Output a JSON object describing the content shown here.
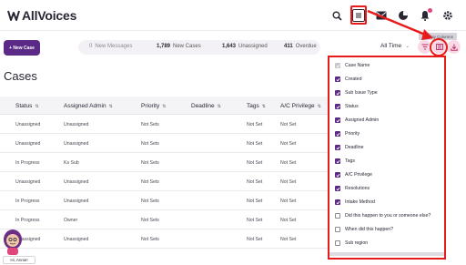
{
  "header": {
    "logo_text": "AllVoices"
  },
  "actions": {
    "new_case_label": "+ New Case",
    "stats": [
      {
        "num": "0",
        "label": "New Messages",
        "muted": true
      },
      {
        "num": "1,789",
        "label": "New Cases",
        "muted": false
      },
      {
        "num": "1,643",
        "label": "Unassigned",
        "muted": false
      },
      {
        "num": "411",
        "label": "Overdue",
        "muted": false
      }
    ],
    "time_filter": "All Time",
    "tooltip": "Display Columns"
  },
  "page": {
    "title": "Cases"
  },
  "table": {
    "headers": [
      "Status",
      "Assigned Admin",
      "Priority",
      "Deadline",
      "Tags",
      "A/C Privilege"
    ],
    "rows": [
      [
        "Unassigned",
        "Unassigned",
        "Not Sets",
        "",
        "Not Set",
        "Not Set"
      ],
      [
        "Unassigned",
        "Unassigned",
        "Not Sets",
        "",
        "Not Set",
        "Not Set"
      ],
      [
        "In Progress",
        "Ks Sub",
        "Not Sets",
        "",
        "Not Set",
        "Not Set"
      ],
      [
        "Unassigned",
        "Unassigned",
        "Not Sets",
        "",
        "Not Set",
        "Not Set"
      ],
      [
        "In Progress",
        "Unassigned",
        "Not Sets",
        "",
        "Not Set",
        "Not Set"
      ],
      [
        "In Progress",
        "Owner",
        "Not Sets",
        "",
        "Not Set",
        "Not Set"
      ],
      [
        "Unassigned",
        "Unassigned",
        "Not Sets",
        "",
        "Not Set",
        "Not Set"
      ]
    ]
  },
  "widget": {
    "greeting": "Hi, Annie!"
  },
  "columns_panel": {
    "items": [
      {
        "label": "Case Name",
        "state": "disabled"
      },
      {
        "label": "Created",
        "state": "checked"
      },
      {
        "label": "Sub Issue Type",
        "state": "checked"
      },
      {
        "label": "Status",
        "state": "checked"
      },
      {
        "label": "Assigned Admin",
        "state": "checked"
      },
      {
        "label": "Priority",
        "state": "checked"
      },
      {
        "label": "Deadline",
        "state": "checked"
      },
      {
        "label": "Tags",
        "state": "checked"
      },
      {
        "label": "A/C Privilege",
        "state": "checked"
      },
      {
        "label": "Resolutions",
        "state": "checked"
      },
      {
        "label": "Intake Method",
        "state": "checked"
      },
      {
        "label": "Did this happen to you or someone else?",
        "state": "unchecked"
      },
      {
        "label": "When did this happen?",
        "state": "unchecked"
      },
      {
        "label": "Sub region",
        "state": "unchecked"
      }
    ]
  },
  "colors": {
    "accent": "#5b2a86",
    "annotation": "#e81b1b",
    "pink": "#f8d9e5"
  }
}
